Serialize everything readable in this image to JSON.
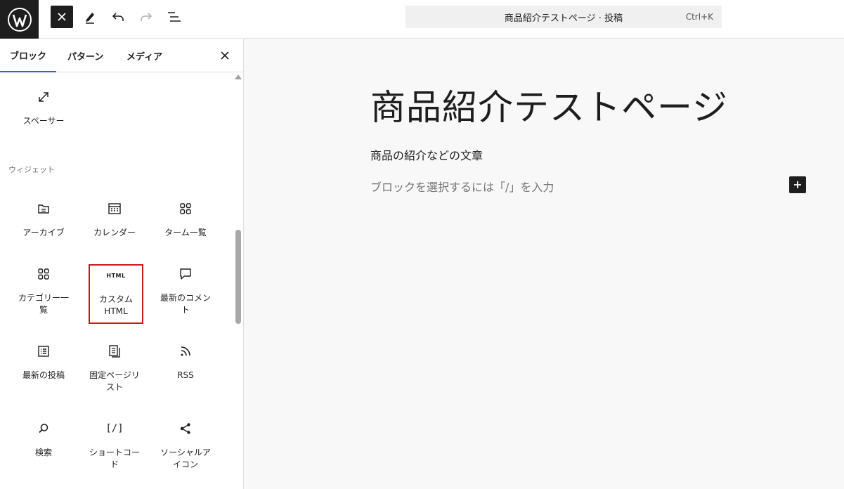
{
  "toolbar": {
    "close_label": "×",
    "command_bar": {
      "title": "商品紹介テストページ · 投稿",
      "shortcut": "Ctrl+K"
    }
  },
  "sidebar": {
    "tabs": [
      {
        "label": "ブロック",
        "active": true
      },
      {
        "label": "パターン",
        "active": false
      },
      {
        "label": "メディア",
        "active": false
      }
    ],
    "section_label": "ウィジェット",
    "blocks": [
      {
        "label": "スペーサー",
        "icon": "spacer-icon"
      },
      {
        "label": "アーカイブ",
        "icon": "archive-icon"
      },
      {
        "label": "カレンダー",
        "icon": "calendar-icon"
      },
      {
        "label": "ターム一覧",
        "icon": "term-list-icon"
      },
      {
        "label": "カテゴリー一覧",
        "icon": "category-icon"
      },
      {
        "label": "カスタムHTML",
        "icon": "html-icon",
        "icon_text": "HTML",
        "selected": true
      },
      {
        "label": "最新のコメント",
        "icon": "comment-icon"
      },
      {
        "label": "最新の投稿",
        "icon": "latest-posts-icon"
      },
      {
        "label": "固定ページリスト",
        "icon": "page-list-icon"
      },
      {
        "label": "RSS",
        "icon": "rss-icon"
      },
      {
        "label": "検索",
        "icon": "search-icon"
      },
      {
        "label": "ショートコード",
        "icon": "shortcode-icon",
        "icon_text": "[/]"
      },
      {
        "label": "ソーシャルアイコン",
        "icon": "share-icon"
      }
    ]
  },
  "editor": {
    "title": "商品紹介テストページ",
    "paragraph": "商品の紹介などの文章",
    "placeholder": "ブロックを選択するには「/」を入力"
  },
  "colors": {
    "accent": "#3858e9",
    "selection": "#cc1818",
    "dark": "#1e1e1e"
  }
}
